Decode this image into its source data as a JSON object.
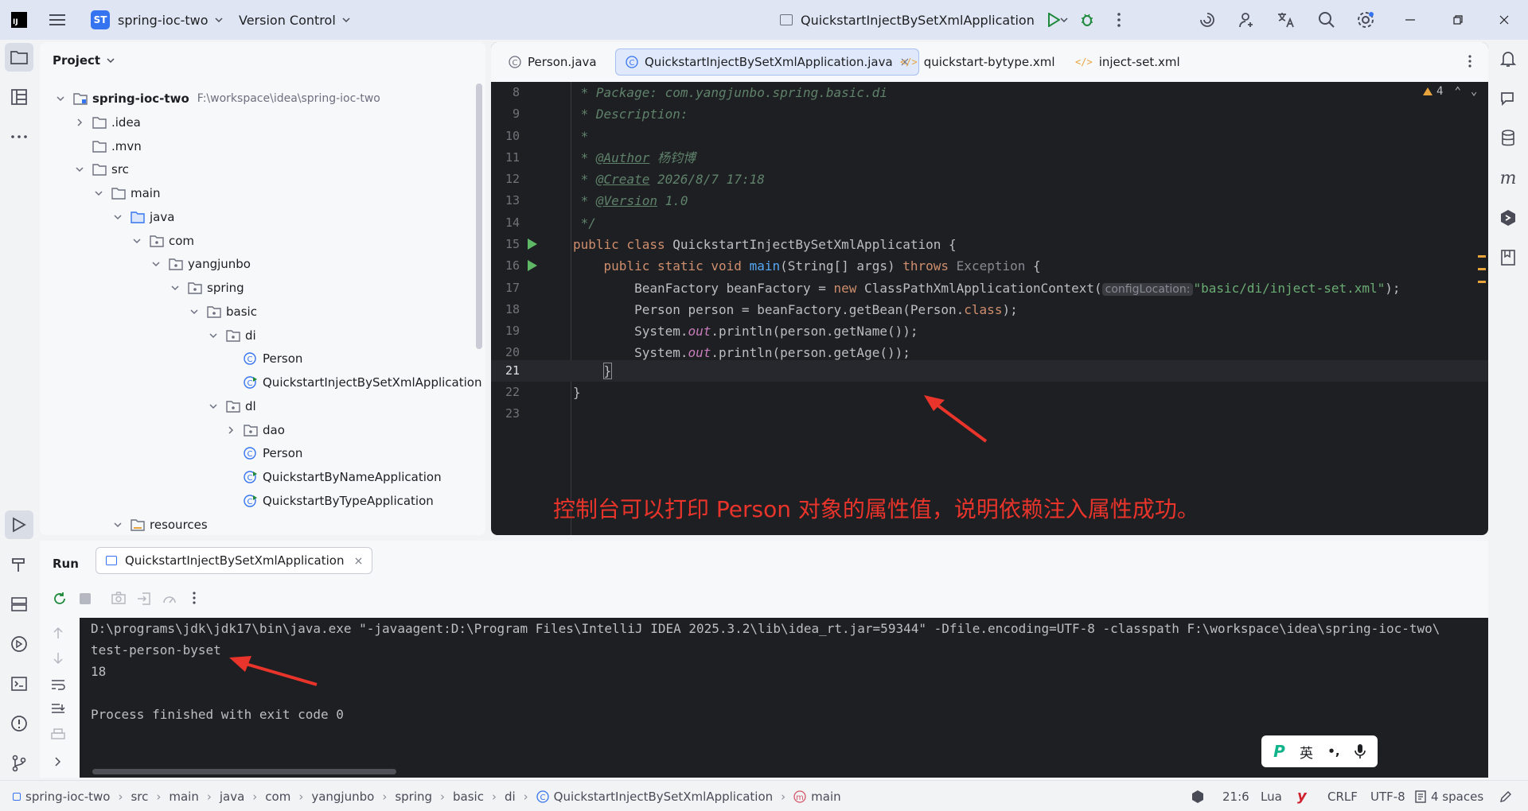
{
  "titlebar": {
    "project_badge": "ST",
    "project_name": "spring-ioc-two",
    "vcs_label": "Version Control",
    "run_config": "QuickstartInjectBySetXmlApplication"
  },
  "project_panel": {
    "title": "Project",
    "root_name": "spring-ioc-two",
    "root_path": "F:\\workspace\\idea\\spring-ioc-two",
    "nodes": [
      ".idea",
      ".mvn",
      "src",
      "main",
      "java",
      "com",
      "yangjunbo",
      "spring",
      "basic",
      "di",
      "Person",
      "QuickstartInjectBySetXmlApplication",
      "dl",
      "dao",
      "Person",
      "QuickstartByNameApplication",
      "QuickstartByTypeApplication",
      "resources"
    ]
  },
  "editor": {
    "tabs": [
      "Person.java",
      "QuickstartInjectBySetXmlApplication.java",
      "quickstart-bytype.xml",
      "inject-set.xml"
    ],
    "warnings": "4",
    "line_numbers": [
      "8",
      "9",
      "10",
      "11",
      "12",
      "13",
      "14",
      "15",
      "16",
      "17",
      "18",
      "19",
      "20",
      "21",
      "22",
      "23"
    ],
    "code": {
      "l8": " * Package: com.yangjunbo.spring.basic.di",
      "l9": " * Description:",
      "l10": " *",
      "l11_tag": "@Author",
      "l11_val": "杨钧博",
      "l12_tag": "@Create",
      "l12_val": "2026/8/7 17:18",
      "l13_tag": "@Version",
      "l13_val": "1.0",
      "l14": " */",
      "class_kw": "public class",
      "class_name": "QuickstartInjectBySetXmlApplication {",
      "main_kw": "public static void",
      "main_name": "main",
      "main_args": "(String[] args)",
      "throws_kw": "throws",
      "exception": "Exception",
      "brace": "{",
      "l17_a": "BeanFactory beanFactory = ",
      "l17_new": "new",
      "l17_b": " ClassPathXmlApplicationContext(",
      "param_hint": "configLocation:",
      "l17_str": "\"basic/di/inject-set.xml\"",
      "l17_end": ");",
      "l18_a": "Person person = beanFactory.getBean(Person.",
      "l18_class": "class",
      "l18_end": ");",
      "l19_a": "System.",
      "l19_out": "out",
      "l19_b": ".println(person.getName());",
      "l20_a": "System.",
      "l20_out": "out",
      "l20_b": ".println(person.getAge());",
      "l21": "}",
      "l22": "}"
    },
    "annotation": "控制台可以打印 Person 对象的属性值，说明依赖注入属性成功。"
  },
  "run_panel": {
    "title": "Run",
    "tab": "QuickstartInjectBySetXmlApplication",
    "console": [
      "D:\\programs\\jdk\\jdk17\\bin\\java.exe \"-javaagent:D:\\Program Files\\IntelliJ IDEA 2025.3.2\\lib\\idea_rt.jar=59344\" -Dfile.encoding=UTF-8 -classpath F:\\workspace\\idea\\spring-ioc-two\\",
      "test-person-byset",
      "18",
      "",
      "Process finished with exit code 0"
    ]
  },
  "ime": {
    "lang": "英",
    "punct": "•,",
    "logo": "P"
  },
  "statusbar": {
    "breadcrumbs": [
      "spring-ioc-two",
      "src",
      "main",
      "java",
      "com",
      "yangjunbo",
      "spring",
      "basic",
      "di",
      "QuickstartInjectBySetXmlApplication",
      "main"
    ],
    "position": "21:6",
    "language": "Lua",
    "line_sep": "CRLF",
    "encoding": "UTF-8",
    "indent": "4 spaces"
  },
  "colors": {
    "accent": "#3574f0",
    "annotation_red": "#e8342b",
    "editor_bg": "#1e1f22"
  }
}
